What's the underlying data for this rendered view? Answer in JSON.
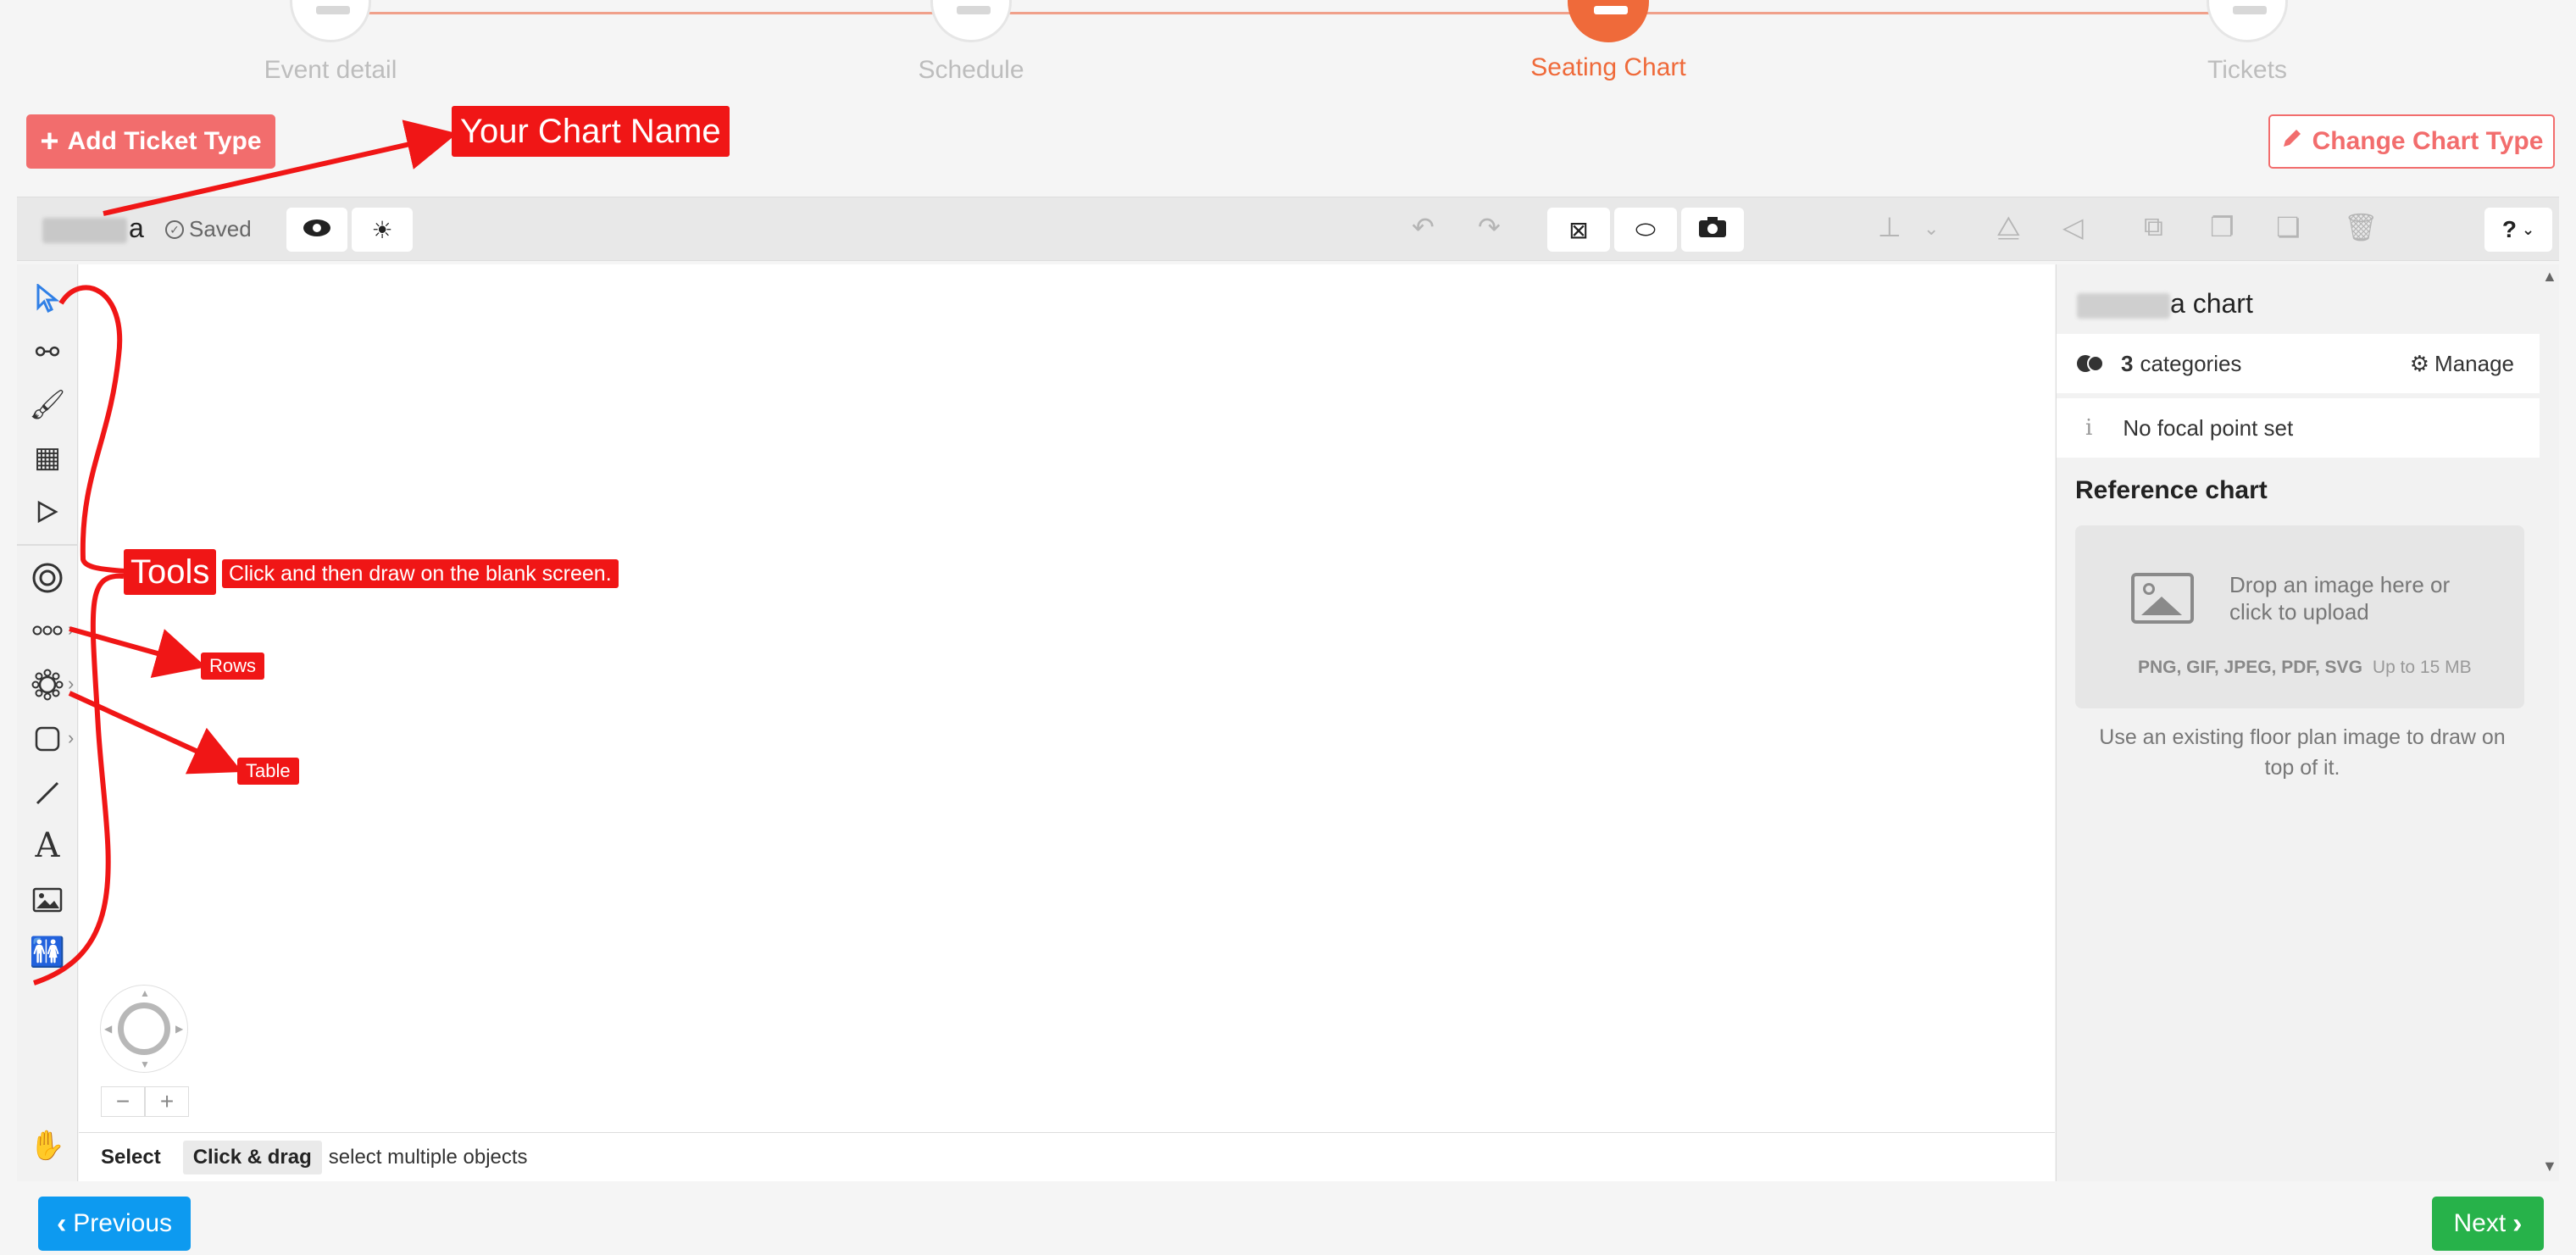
{
  "stepper": {
    "steps": [
      {
        "label": "Event detail",
        "active": false
      },
      {
        "label": "Schedule",
        "active": false
      },
      {
        "label": "Seating Chart",
        "active": true
      },
      {
        "label": "Tickets",
        "active": false
      }
    ]
  },
  "actions": {
    "add_ticket_type": "Add Ticket Type",
    "change_chart_type": "Change Chart Type"
  },
  "toolbar": {
    "chart_name_suffix": "a",
    "saved_label": "Saved",
    "buttons": [
      "eye-icon",
      "sun-icon",
      "undo-icon",
      "redo-icon",
      "focus-icon",
      "label-icon",
      "camera-icon",
      "align-icon",
      "flip-icon",
      "skew-icon",
      "group-icon",
      "duplicate-icon",
      "copy-icon",
      "delete-icon",
      "help-icon"
    ],
    "help_label": "?"
  },
  "tools": {
    "items": [
      "select-pointer-icon",
      "multi-select-icon",
      "brush-icon",
      "shapes-icon",
      "node-pointer-icon",
      "focal-point-icon",
      "rows-icon",
      "table-icon",
      "rectangle-icon",
      "line-icon",
      "text-icon",
      "image-icon",
      "restroom-icon",
      "hand-icon"
    ],
    "text_tool_glyph": "A"
  },
  "status": {
    "mode": "Select",
    "shortcut": "Click & drag",
    "hint": "select multiple objects"
  },
  "panel": {
    "chart_title_suffix": "a chart",
    "categories_count": "3",
    "categories_label": "categories",
    "manage_label": "Manage",
    "focal_point": "No focal point set",
    "reference_title": "Reference chart",
    "dropzone_text": "Drop an image here or click to upload",
    "formats": "PNG, GIF, JPEG, PDF, SVG",
    "size_limit": "Up to 15 MB",
    "help": "Use an existing floor plan image to draw on top of it."
  },
  "nav": {
    "previous": "Previous",
    "next": "Next"
  },
  "annotations": {
    "chart_name": "Your Chart Name",
    "tools": "Tools",
    "tools_desc": "Click and then draw on the blank screen.",
    "rows": "Rows",
    "table": "Table"
  },
  "colors": {
    "accent": "#ef6a3a",
    "add_button": "#f26d6d",
    "previous_button": "#0d9af0",
    "next_button": "#27b24a",
    "annotation": "#f01616"
  }
}
